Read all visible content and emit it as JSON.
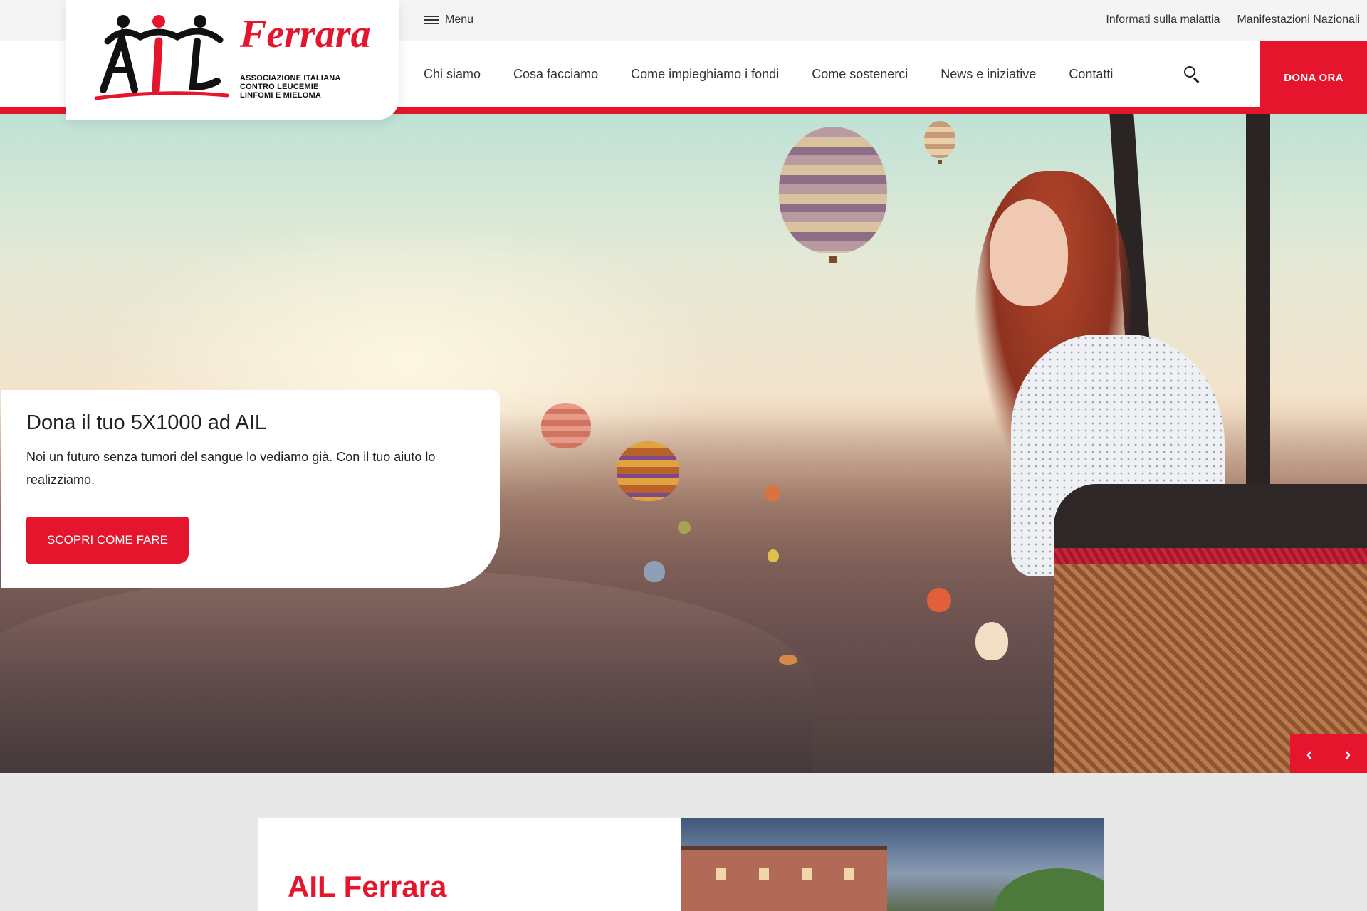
{
  "brand": {
    "logo_letters": "AIL",
    "city": "Ferrara",
    "subtitle_lines": [
      "ASSOCIAZIONE ITALIANA",
      "CONTRO LEUCEMIE",
      "LINFOMI E MIELOMA"
    ],
    "accent_color": "#e4152d"
  },
  "topbar": {
    "menu_label": "Menu",
    "menu_icon": "hamburger-icon",
    "links": [
      "Informati sulla malattia",
      "Manifestazioni Nazionali"
    ]
  },
  "nav": {
    "items": [
      "Chi siamo",
      "Cosa facciamo",
      "Come impieghiamo i fondi",
      "Come sostenerci",
      "News e iniziative",
      "Contatti"
    ],
    "search_icon": "search-icon",
    "donate_label": "DONA ORA"
  },
  "hero": {
    "title": "Dona il tuo 5X1000 ad AIL",
    "text": "Noi un futuro senza tumori del sangue lo vediamo già. Con il tuo aiuto lo realizziamo.",
    "cta_label": "SCOPRI COME FARE",
    "prev_icon": "chevron-left-icon",
    "next_icon": "chevron-right-icon",
    "prev_glyph": "‹",
    "next_glyph": "›"
  },
  "intro": {
    "title": "AIL Ferrara"
  }
}
